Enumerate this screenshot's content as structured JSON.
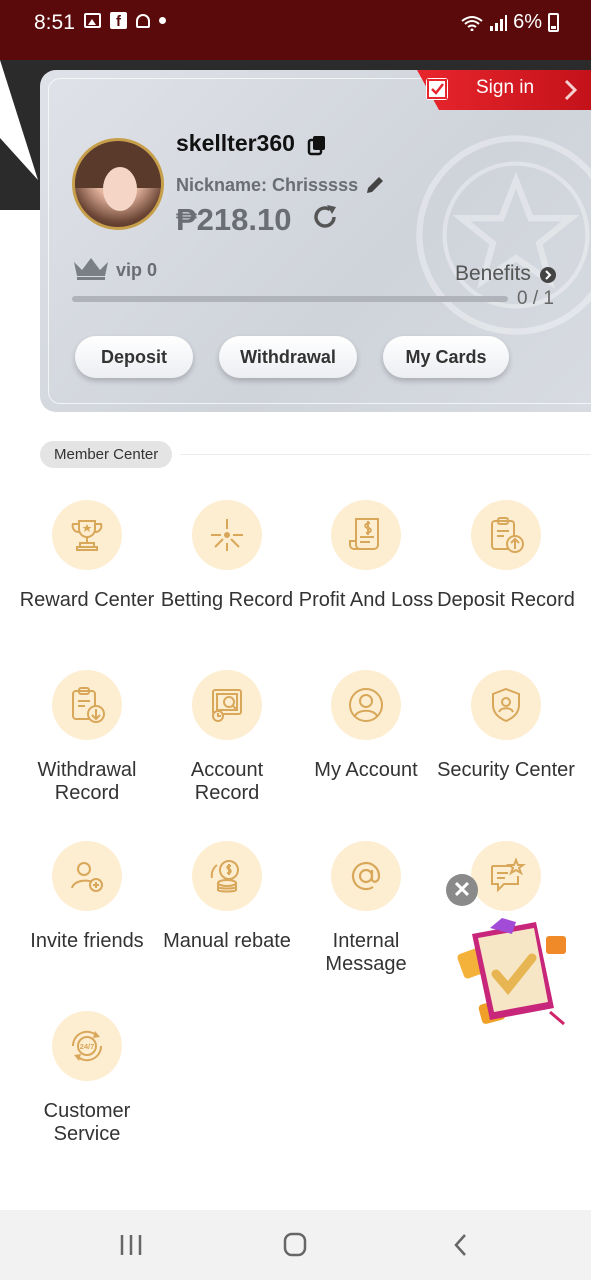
{
  "status_bar": {
    "time": "8:51",
    "battery": "6%"
  },
  "header": {
    "sign_in_label": "Sign in",
    "username": "skellter360",
    "nickname": "Nickname: Chrisssss",
    "balance": "₱218.10",
    "vip_label": "vip 0",
    "benefits_label": "Benefits",
    "progress_text": "0 / 1",
    "progress_fraction": 0
  },
  "actions": [
    {
      "label": "Deposit"
    },
    {
      "label": "Withdrawal"
    },
    {
      "label": "My Cards"
    }
  ],
  "member_center": {
    "title": "Member Center",
    "items": [
      {
        "label": "Reward Center",
        "icon": "trophy-icon"
      },
      {
        "label": "Betting Record",
        "icon": "betting-icon"
      },
      {
        "label": "Profit And Loss",
        "icon": "receipt-icon"
      },
      {
        "label": "Deposit Record",
        "icon": "clipboard-upload-icon"
      },
      {
        "label": "Withdrawal Record",
        "icon": "clipboard-download-icon"
      },
      {
        "label": "Account Record",
        "icon": "account-record-icon"
      },
      {
        "label": "My Account",
        "icon": "user-circle-icon"
      },
      {
        "label": "Security Center",
        "icon": "shield-user-icon"
      },
      {
        "label": "Invite friends",
        "icon": "invite-user-icon"
      },
      {
        "label": "Manual rebate",
        "icon": "coins-icon"
      },
      {
        "label": "Internal Message",
        "icon": "at-icon"
      },
      {
        "label": "",
        "icon": "message-star-icon"
      },
      {
        "label": "Customer Service",
        "icon": "support-24-7-icon"
      }
    ]
  },
  "colors": {
    "accent": "#e02a2a",
    "icon_bg": "#fdeed2",
    "icon_stroke": "#d9a75a"
  }
}
